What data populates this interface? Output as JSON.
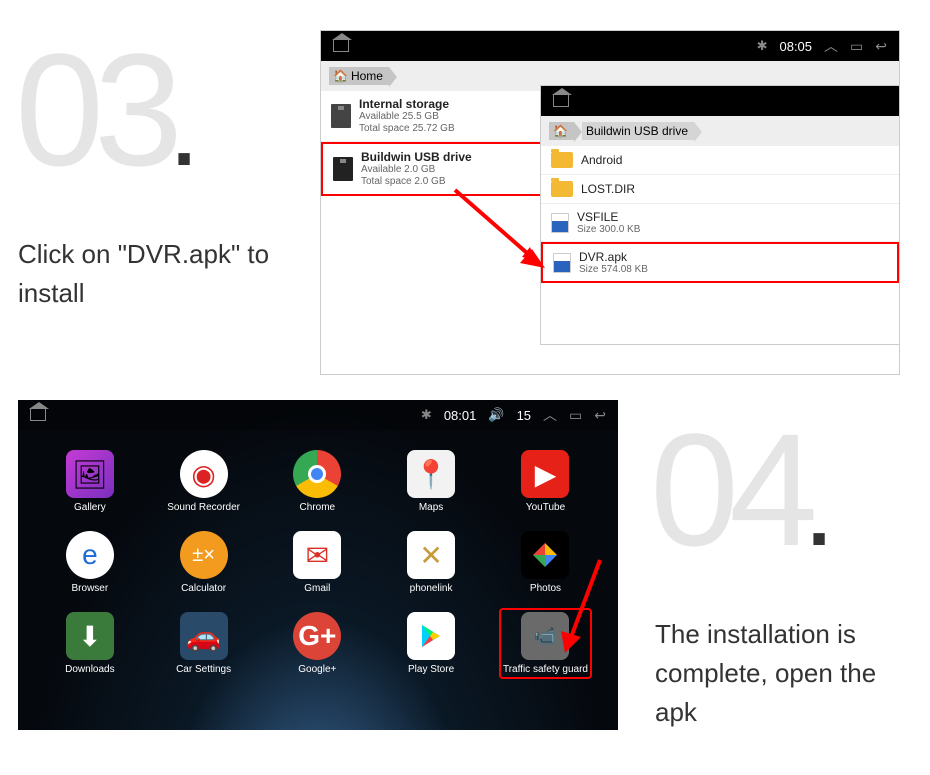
{
  "step3": {
    "number": "03",
    "caption": "Click on  \"DVR.apk\" to install"
  },
  "step4": {
    "number": "04",
    "caption": "The installation is complete, open the apk"
  },
  "statusbar1": {
    "time": "08:05"
  },
  "statusbar2": {
    "time": "08:01",
    "extra": "15"
  },
  "fm1": {
    "breadcrumb_home": "Home",
    "storage": [
      {
        "title": "Internal storage",
        "available": "Available 25.5 GB",
        "total": "Total space 25.72 GB"
      },
      {
        "title": "Buildwin USB drive",
        "available": "Available 2.0 GB",
        "total": "Total space 2.0 GB"
      }
    ]
  },
  "fm2": {
    "breadcrumb_drive": "Buildwin USB drive",
    "files": [
      {
        "type": "folder",
        "title": "Android",
        "sub": ""
      },
      {
        "type": "folder",
        "title": "LOST.DIR",
        "sub": ""
      },
      {
        "type": "file",
        "title": "VSFILE",
        "sub": "Size 300.0 KB"
      },
      {
        "type": "file",
        "title": "DVR.apk",
        "sub": "Size 574.08 KB"
      }
    ]
  },
  "apps": [
    {
      "label": "Gallery"
    },
    {
      "label": "Sound Recorder"
    },
    {
      "label": "Chrome"
    },
    {
      "label": "Maps"
    },
    {
      "label": "YouTube"
    },
    {
      "label": "Browser"
    },
    {
      "label": "Calculator"
    },
    {
      "label": "Gmail"
    },
    {
      "label": "phonelink"
    },
    {
      "label": "Photos"
    },
    {
      "label": "Downloads"
    },
    {
      "label": "Car Settings"
    },
    {
      "label": "Google+"
    },
    {
      "label": "Play Store"
    },
    {
      "label": "Traffic safety guard"
    }
  ]
}
